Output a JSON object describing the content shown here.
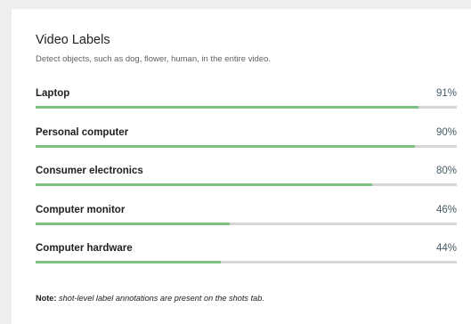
{
  "panel": {
    "title": "Video Labels",
    "subtitle": "Detect objects, such as dog, flower, human, in the entire video."
  },
  "labels": [
    {
      "name": "Laptop",
      "percent_text": "91%",
      "confidence": 0.91
    },
    {
      "name": "Personal computer",
      "percent_text": "90%",
      "confidence": 0.9
    },
    {
      "name": "Consumer electronics",
      "percent_text": "80%",
      "confidence": 0.8
    },
    {
      "name": "Computer monitor",
      "percent_text": "46%",
      "confidence": 0.46
    },
    {
      "name": "Computer hardware",
      "percent_text": "44%",
      "confidence": 0.44
    }
  ],
  "note": {
    "prefix": "Note:",
    "text": " shot-level label annotations are present on the shots tab."
  },
  "colors": {
    "bar_fill": "#7cbf7f",
    "bar_track": "#d6d6d6"
  }
}
